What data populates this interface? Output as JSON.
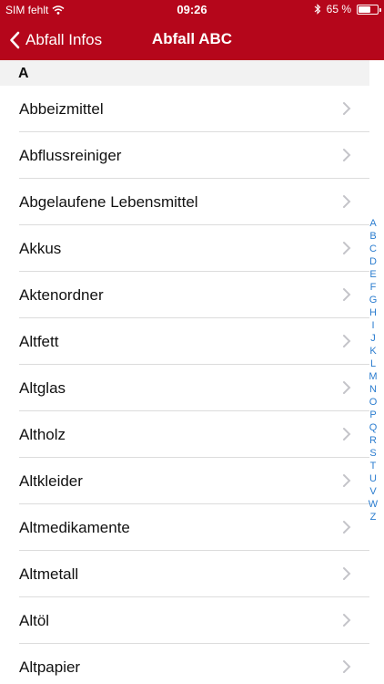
{
  "status_bar": {
    "carrier": "SIM fehlt",
    "time": "09:26",
    "battery_text": "65 %",
    "battery_level": 0.65
  },
  "nav": {
    "back_label": "Abfall Infos",
    "title": "Abfall ABC"
  },
  "section": {
    "letter": "A"
  },
  "items": [
    "Abbeizmittel",
    "Abflussreiniger",
    "Abgelaufene Lebensmittel",
    "Akkus",
    "Aktenordner",
    "Altfett",
    "Altglas",
    "Altholz",
    "Altkleider",
    "Altmedikamente",
    "Altmetall",
    "Altöl",
    "Altpapier"
  ],
  "index_letters": [
    "A",
    "B",
    "C",
    "D",
    "E",
    "F",
    "G",
    "H",
    "I",
    "J",
    "K",
    "L",
    "M",
    "N",
    "O",
    "P",
    "Q",
    "R",
    "S",
    "T",
    "U",
    "V",
    "W",
    "Z"
  ],
  "colors": {
    "header": "#b5061b",
    "index": "#2a7ccf",
    "section_bg": "#f2f2f2"
  }
}
